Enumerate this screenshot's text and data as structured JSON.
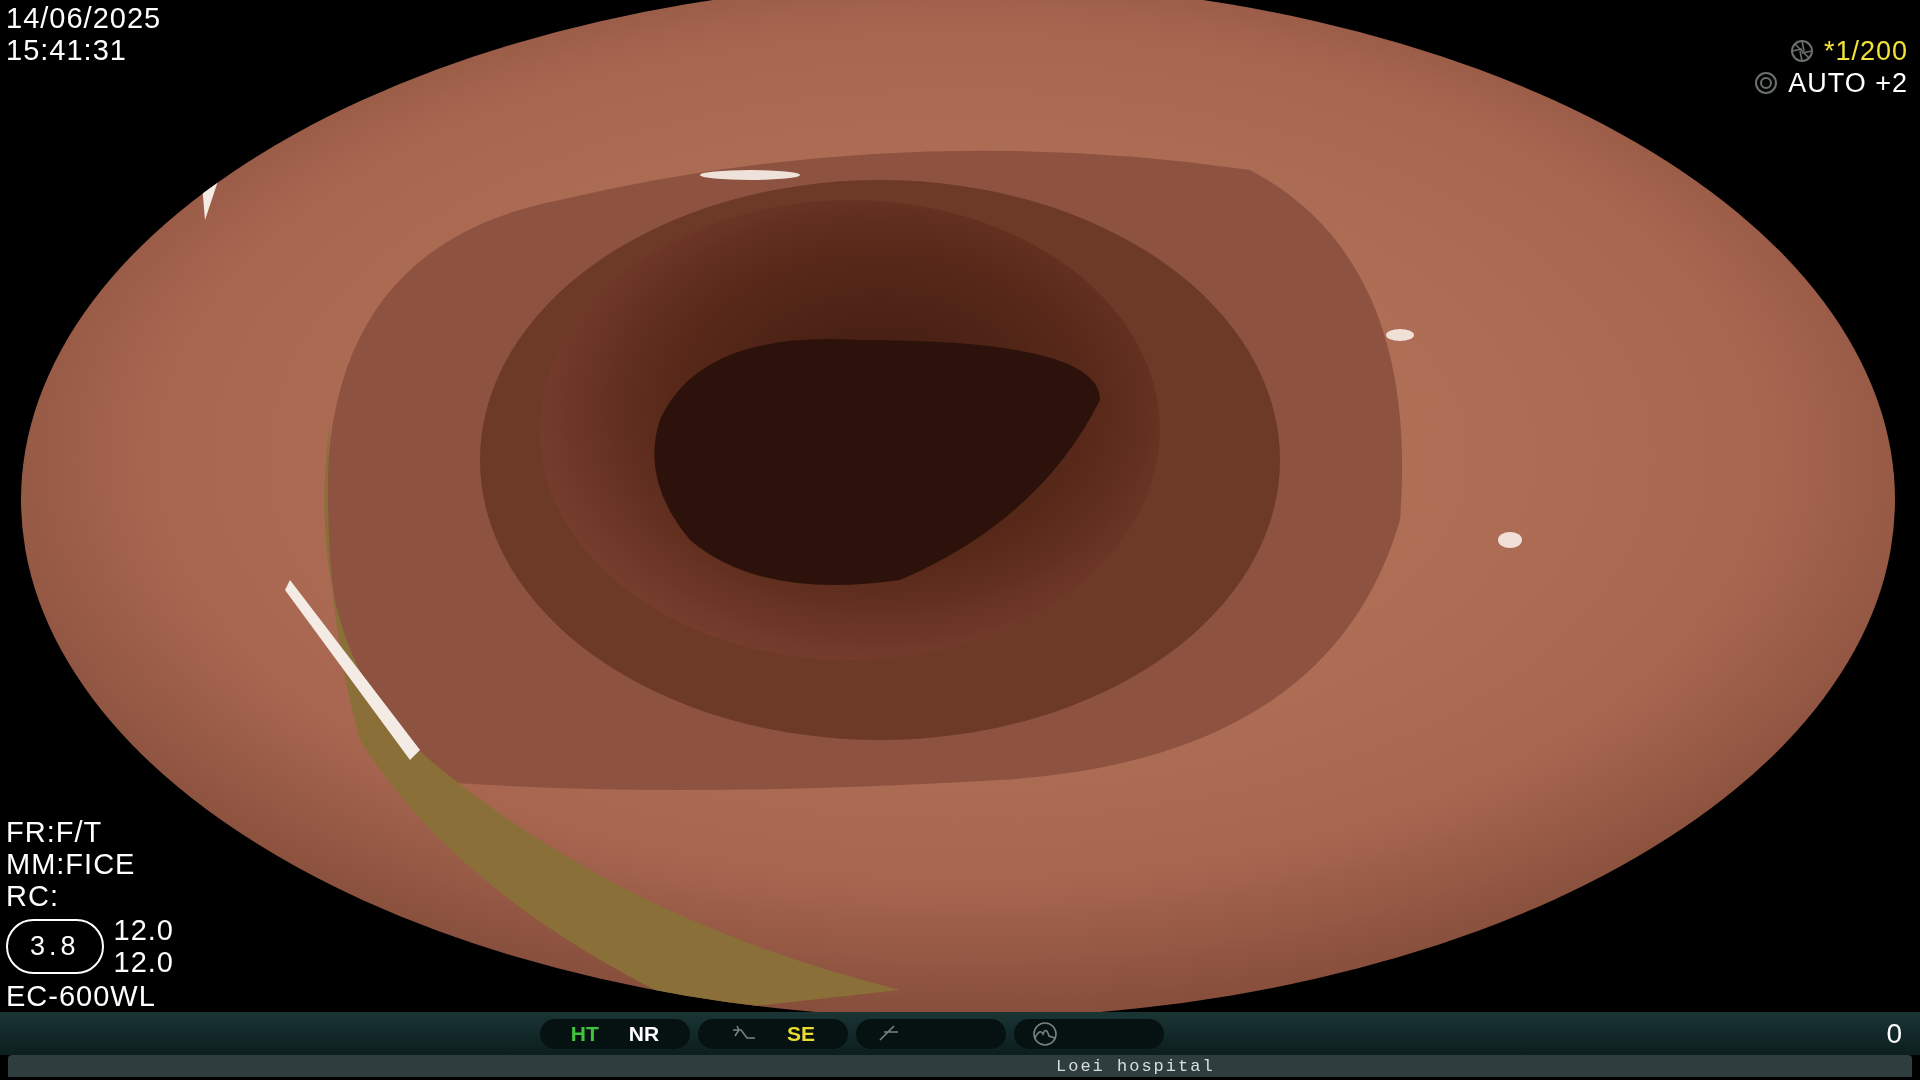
{
  "datetime": {
    "date": "14/06/2025",
    "time": "15:41:31"
  },
  "settings": [
    {
      "kind": "shutter",
      "text": "*1/200",
      "color": "#f2e23a"
    },
    {
      "kind": "iris",
      "text": "AUTO +2",
      "color": "#ffffff"
    }
  ],
  "info_lines": [
    "FR:F/T",
    "MM:FICE",
    "RC:"
  ],
  "zoom_badge": "3.8",
  "readings": [
    "12.0",
    "12.0"
  ],
  "scope_model": "EC-600WL",
  "status_bar": {
    "groups": [
      {
        "kind": "modes",
        "items": [
          {
            "text": "HT",
            "color": "#3ec43e"
          },
          {
            "text": "NR",
            "color": "#ffffff"
          }
        ]
      },
      {
        "kind": "enhance",
        "items": [
          {
            "text": "SE",
            "color": "#e8dc30"
          }
        ]
      },
      {
        "kind": "curve"
      },
      {
        "kind": "histogram"
      }
    ],
    "counter": "0",
    "hospital": "Loei hospital"
  }
}
